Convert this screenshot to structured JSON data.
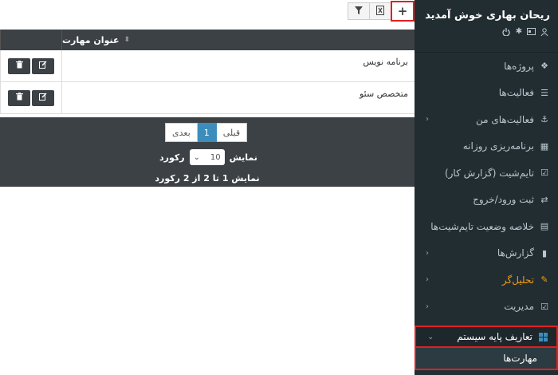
{
  "sidebar": {
    "welcome": "ریحان بهاری خوش آمدید",
    "items": [
      {
        "label": "پروژه‌ها",
        "icon": "cubes-icon"
      },
      {
        "label": "فعالیت‌ها",
        "icon": "list-icon"
      },
      {
        "label": "فعالیت‌های من",
        "icon": "anchor-icon",
        "has_children": true
      },
      {
        "label": "برنامه‌ریزی روزانه",
        "icon": "table-icon"
      },
      {
        "label": "تایم‌شیت (گزارش کار)",
        "icon": "calendar-check-icon"
      },
      {
        "label": "ثبت ورود/خروج",
        "icon": "exchange-icon"
      },
      {
        "label": "خلاصه وضعیت تایم‌شیت‌ها",
        "icon": "list-alt-icon"
      },
      {
        "label": "گزارش‌ها",
        "icon": "file-icon",
        "has_children": true
      },
      {
        "label": "تحلیل‌گر",
        "icon": "magic-icon",
        "has_children": true,
        "color": "#f39c12"
      },
      {
        "label": "مدیریت",
        "icon": "check-square-icon",
        "has_children": true
      },
      {
        "label": "تعاریف پایه سیستم",
        "icon": "windows-icon",
        "has_children": true,
        "active": true
      }
    ],
    "subitem": "مهارت‌ها"
  },
  "toolbar": {
    "add": "+",
    "excel_icon": "excel-icon",
    "filter_icon": "filter-icon"
  },
  "table": {
    "header": "عنوان مهارت",
    "rows": [
      {
        "title": "برنامه نویس"
      },
      {
        "title": "متخصص سئو"
      }
    ]
  },
  "pager": {
    "prev": "قبلی",
    "current": "1",
    "next": "بعدی"
  },
  "perpage": {
    "show": "نمایش",
    "value": "10",
    "records": "رکورد"
  },
  "info": "نمایش 1 تا 2 از 2 رکورد",
  "colors": {
    "sidebar_bg": "#222d32",
    "header_bg": "#3c4145",
    "accent": "#3c8dbc",
    "highlight": "#e02020",
    "orange": "#f39c12"
  }
}
